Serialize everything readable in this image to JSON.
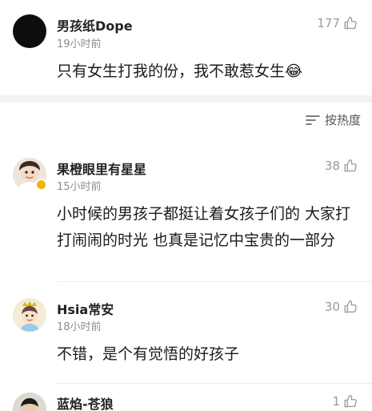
{
  "comments": [
    {
      "user": "男孩纸Dope",
      "time": "19小时前",
      "likes": "177",
      "text": "只有女生打我的份，我不敢惹女生",
      "emoji": "😂"
    },
    {
      "user": "果橙眼里有星星",
      "time": "15小时前",
      "likes": "38",
      "text": "小时候的男孩子都挺让着女孩子们的 大家打打闹闹的时光 也真是记忆中宝贵的一部分"
    },
    {
      "user": "Hsia常安",
      "time": "18小时前",
      "likes": "30",
      "text": "不错，是个有觉悟的好孩子"
    },
    {
      "user": "蓝焰-苍狼",
      "likes": "1"
    }
  ],
  "sort": {
    "label": "按热度",
    "icon": "sort-lines-icon"
  },
  "icons": {
    "like": "thumbs-up-outline-icon",
    "verified": "verified-badge-icon"
  },
  "colors": {
    "meta_gray": "#8e8e8e",
    "section_gap": "#f2f2f2",
    "badge_gold": "#f5b301"
  }
}
